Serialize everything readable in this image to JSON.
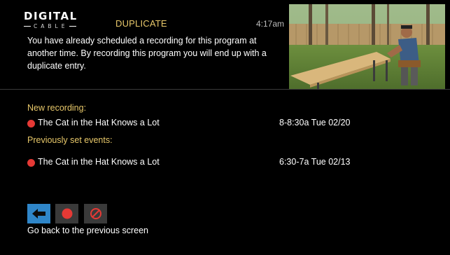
{
  "header": {
    "brand_main": "DIGITAL",
    "brand_sub": "CABLE",
    "title": "DUPLICATE",
    "time": "4:17am"
  },
  "message": "You have already scheduled a recording for this program at another time. By recording this program you will end up with a duplicate entry.",
  "new_recording": {
    "label": "New recording:",
    "items": [
      {
        "title": "The Cat in the Hat Knows a Lot",
        "time": "8-8:30a  Tue 02/20"
      }
    ]
  },
  "previous_events": {
    "label": "Previously set events:",
    "items": [
      {
        "title": "The Cat in the Hat Knows a Lot",
        "time": "6:30-7a  Tue 02/13"
      }
    ]
  },
  "actions": [
    {
      "icon": "back-arrow-icon",
      "selected": true
    },
    {
      "icon": "record-icon",
      "selected": false
    },
    {
      "icon": "cancel-icon",
      "selected": false
    }
  ],
  "hint": "Go back to the previous screen",
  "colors": {
    "accent_gold": "#e8c86a",
    "record_red": "#e53935",
    "selected_blue": "#2f86c9",
    "button_gray": "#3a3a3a"
  }
}
